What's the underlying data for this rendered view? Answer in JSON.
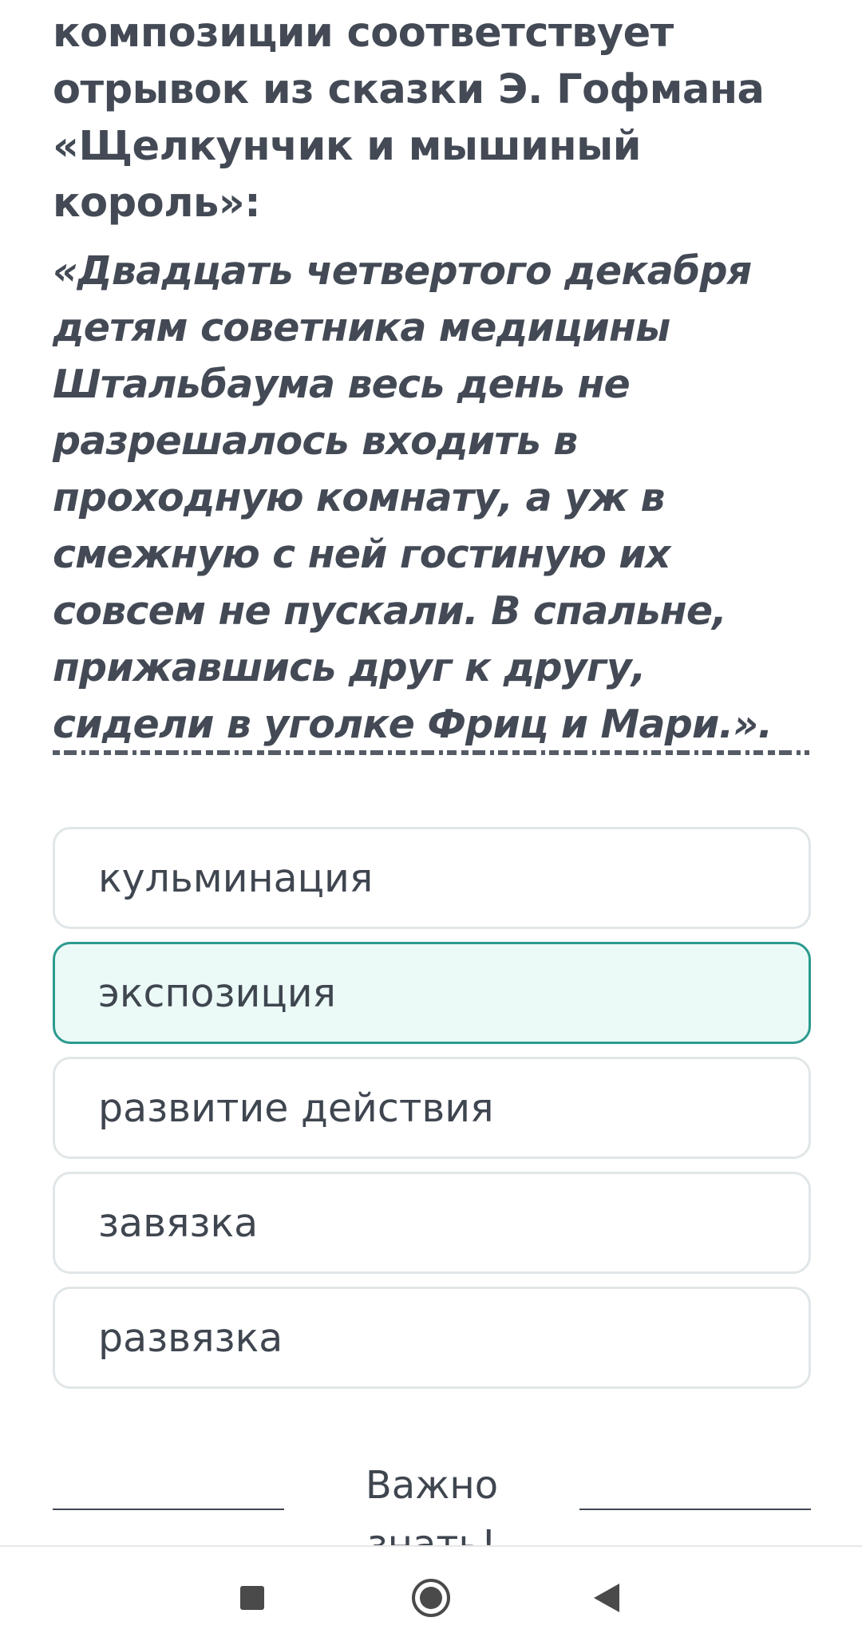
{
  "question": {
    "text": "композиции соответствует отрывок из сказки Э. Гофмана «Щелкунчик и мышиный король»:",
    "quote": "«Двадцать четвертого декабря детям советника медицины Штальбаума весь день не разрешалось входить в проходную комнату, а уж в смежную с ней гостиную их совсем не пускали. В спальне, прижавшись друг к другу, сидели в уголке Фриц и Мари.»."
  },
  "options": [
    {
      "label": "кульминация",
      "selected": false
    },
    {
      "label": "экспозиция",
      "selected": true
    },
    {
      "label": "развитие действия",
      "selected": false
    },
    {
      "label": "завязка",
      "selected": false
    },
    {
      "label": "развязка",
      "selected": false
    }
  ],
  "important_section": {
    "label": "Важно знать!"
  },
  "navbar": {
    "recents_icon": "square-recents-icon",
    "home_icon": "circle-home-icon",
    "back_icon": "triangle-back-icon"
  },
  "colors": {
    "text": "#434a55",
    "selected_border": "#2b9a8e",
    "selected_background": "#ebfaf6",
    "option_border": "#e1e6e8"
  }
}
